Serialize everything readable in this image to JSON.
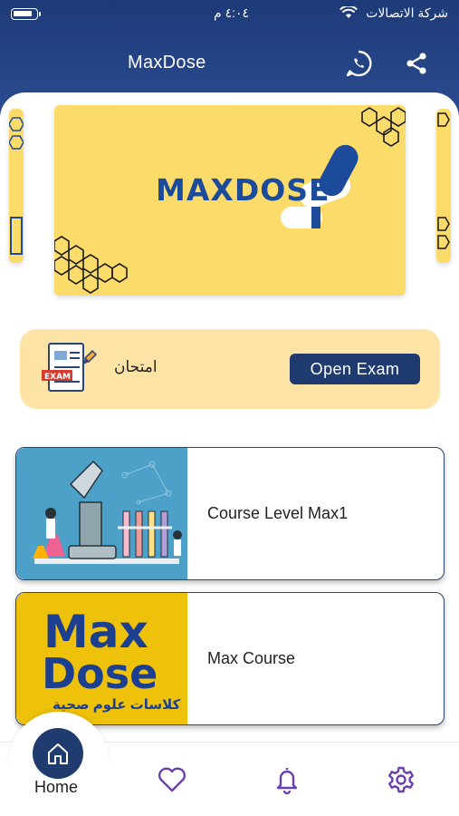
{
  "status_bar": {
    "carrier": "شركة الاتصالات",
    "time": "٤:٠٤ م"
  },
  "app_bar": {
    "title": "MaxDose",
    "icons": [
      "whatsapp-icon",
      "share-icon"
    ]
  },
  "banner": {
    "brand_text": "MAXDOSE"
  },
  "exam_card": {
    "label": "امتحان",
    "button_label": "Open Exam",
    "icon": "exam-icon"
  },
  "courses": [
    {
      "title": "Course Level Max1",
      "thumb": "lab-illustration"
    },
    {
      "title": "Max Course",
      "thumb": "maxdose-logo",
      "thumb_text_top": "Max",
      "thumb_text_bottom": "Dose",
      "thumb_caption": "كلاسات علوم صحية"
    }
  ],
  "bottom_nav": {
    "home_label": "Home",
    "items": [
      "home-icon",
      "heart-icon",
      "bell-icon",
      "settings-icon"
    ]
  },
  "colors": {
    "primary": "#1f3b70",
    "banner_yellow": "#fbdc6b",
    "exam_card_bg": "#fde3a6",
    "nav_icon": "#6a3fb0"
  }
}
